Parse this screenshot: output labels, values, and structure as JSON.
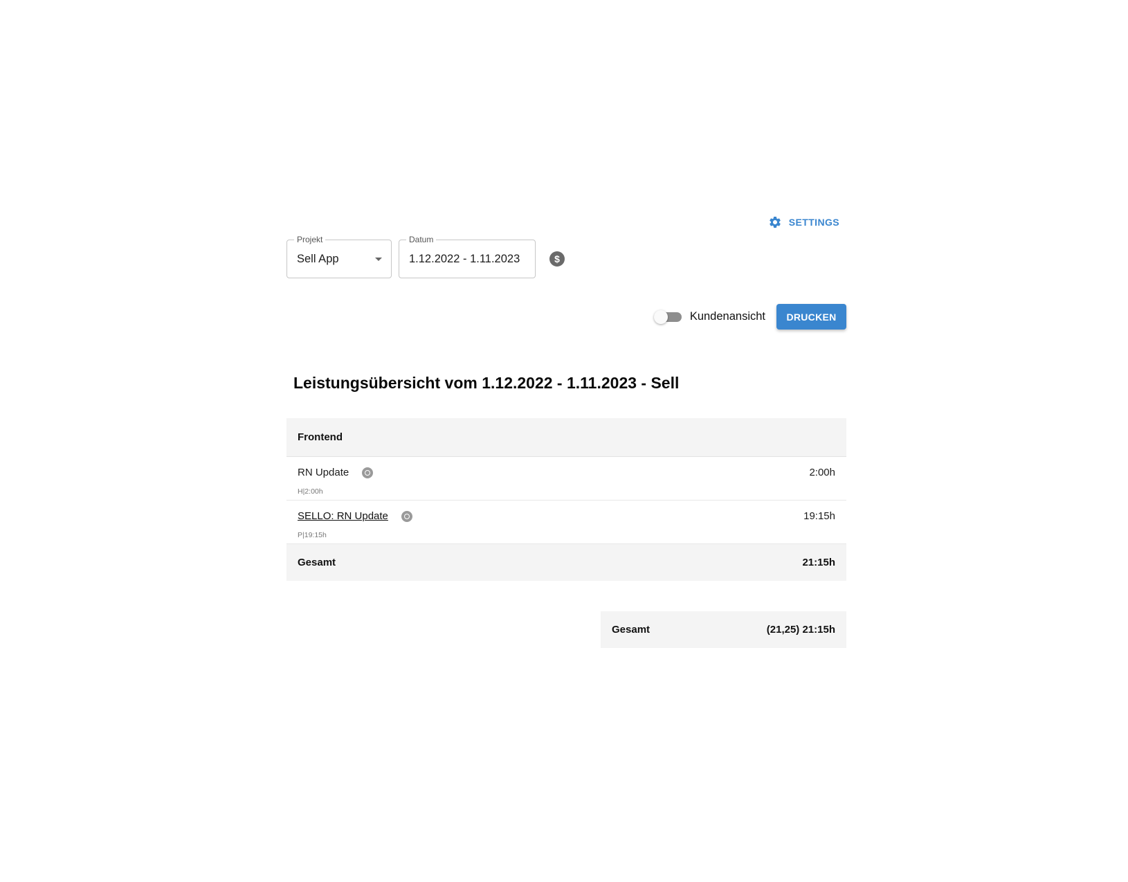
{
  "header": {
    "settings_label": "SETTINGS",
    "settings_icon": "gear-icon"
  },
  "filters": {
    "project": {
      "label": "Projekt",
      "value": "Sell App"
    },
    "date": {
      "label": "Datum",
      "value": "1.12.2022 - 1.11.2023"
    },
    "dollar_icon_glyph": "$"
  },
  "actions": {
    "customer_view_label": "Kundenansicht",
    "customer_view_enabled": false,
    "print_label": "DRUCKEN"
  },
  "report": {
    "title": "Leistungsübersicht vom 1.12.2022 - 1.11.2023 - Sell",
    "groups": [
      {
        "name": "Frontend",
        "entries": [
          {
            "title": "RN Update",
            "subtitle": "H|2:00h",
            "time": "2:00h",
            "linked": false
          },
          {
            "title": "SELLO: RN Update",
            "subtitle": "P|19:15h",
            "time": "19:15h",
            "linked": true
          }
        ],
        "total_label": "Gesamt",
        "total_value": "21:15h"
      }
    ],
    "grand_total": {
      "label": "Gesamt",
      "value": "(21,25) 21:15h"
    }
  },
  "colors": {
    "accent": "#3a86cf",
    "row_background": "#f4f4f4"
  }
}
